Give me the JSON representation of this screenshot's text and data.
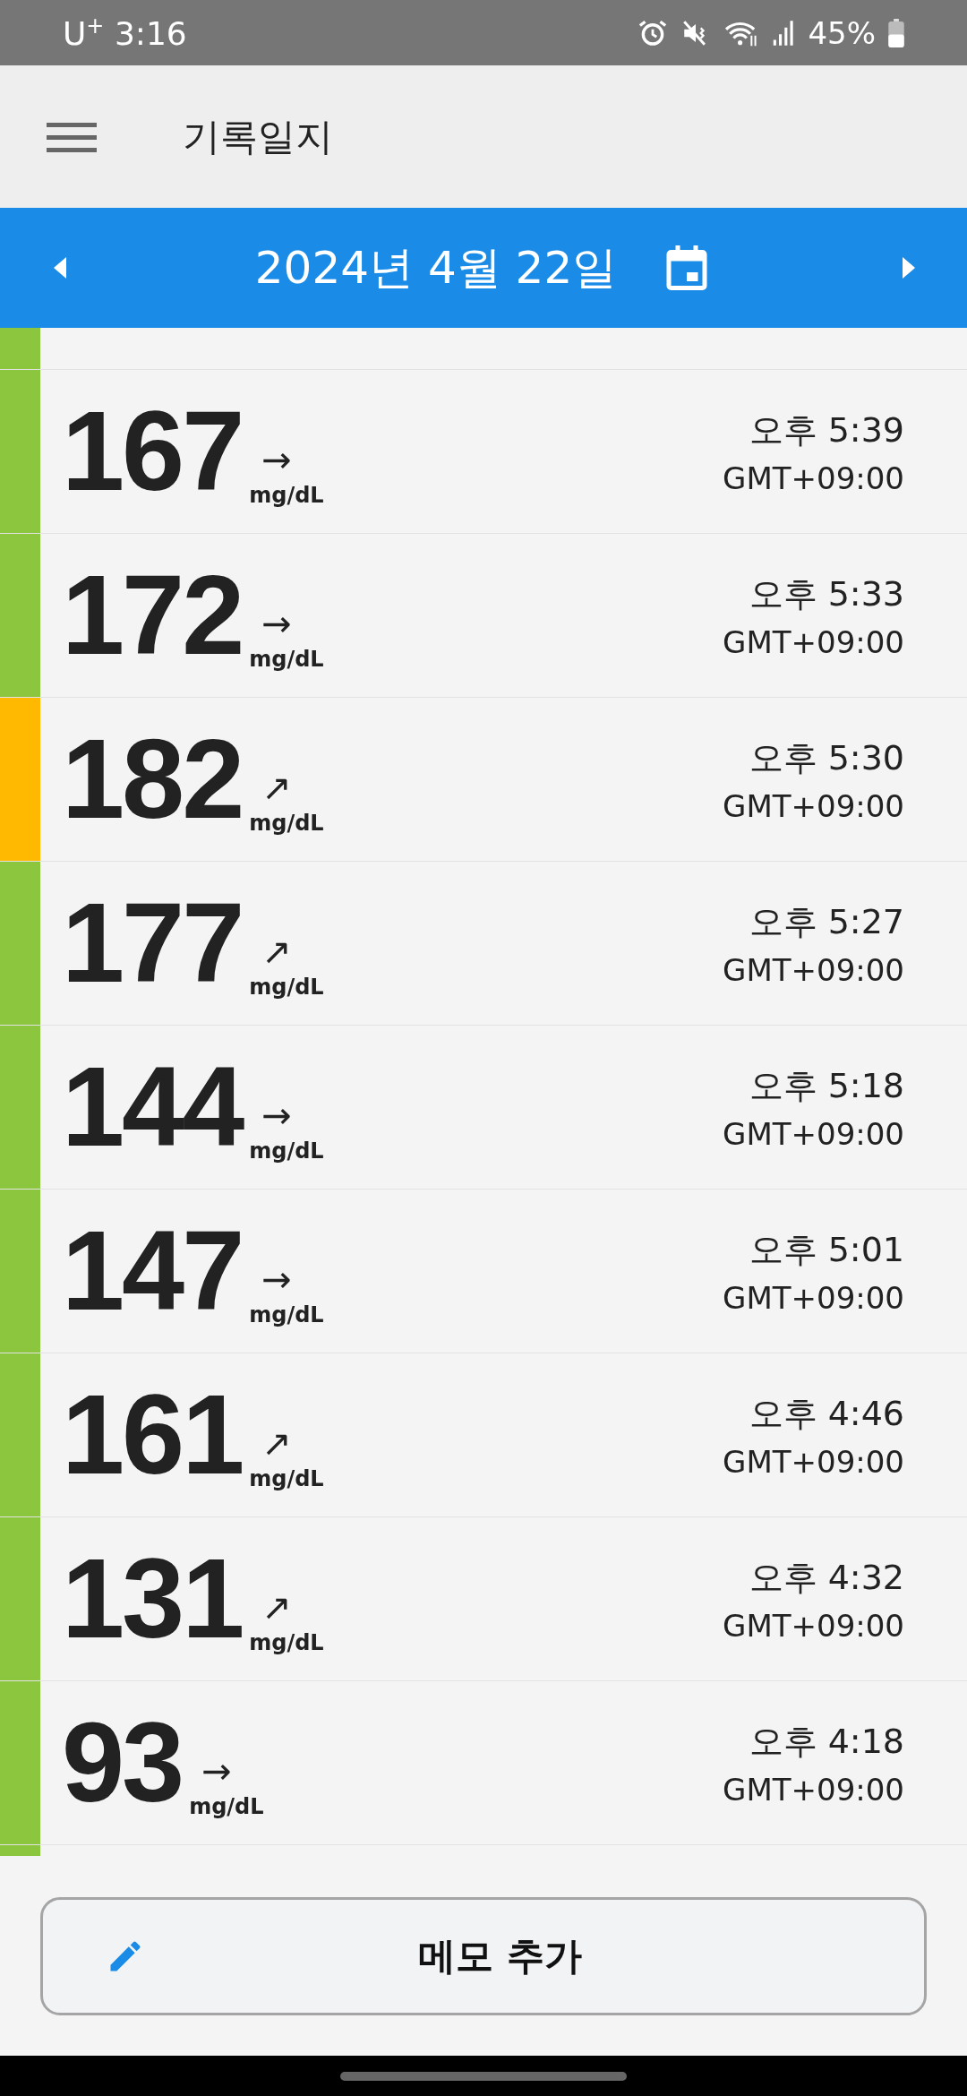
{
  "status_bar": {
    "carrier_time": "U$^{+}$ 3:16",
    "battery": "45%"
  },
  "app_bar": {
    "title": "기록일지"
  },
  "date_bar": {
    "date": "2024년 4월 22일"
  },
  "readings": [
    {
      "kind": "partial",
      "color": "#8cc63f"
    },
    {
      "kind": "reading",
      "value": "167",
      "arrow": "→",
      "unit": "mg/dL",
      "time": "오후 5:39",
      "zone": "GMT+09:00",
      "color": "#8cc63f"
    },
    {
      "kind": "reading",
      "value": "172",
      "arrow": "→",
      "unit": "mg/dL",
      "time": "오후 5:33",
      "zone": "GMT+09:00",
      "color": "#8cc63f"
    },
    {
      "kind": "reading",
      "value": "182",
      "arrow": "↗",
      "unit": "mg/dL",
      "time": "오후 5:30",
      "zone": "GMT+09:00",
      "color": "#ffb900"
    },
    {
      "kind": "reading",
      "value": "177",
      "arrow": "↗",
      "unit": "mg/dL",
      "time": "오후 5:27",
      "zone": "GMT+09:00",
      "color": "#8cc63f"
    },
    {
      "kind": "reading",
      "value": "144",
      "arrow": "→",
      "unit": "mg/dL",
      "time": "오후 5:18",
      "zone": "GMT+09:00",
      "color": "#8cc63f"
    },
    {
      "kind": "reading",
      "value": "147",
      "arrow": "→",
      "unit": "mg/dL",
      "time": "오후 5:01",
      "zone": "GMT+09:00",
      "color": "#8cc63f"
    },
    {
      "kind": "reading",
      "value": "161",
      "arrow": "↗",
      "unit": "mg/dL",
      "time": "오후 4:46",
      "zone": "GMT+09:00",
      "color": "#8cc63f"
    },
    {
      "kind": "reading",
      "value": "131",
      "arrow": "↗",
      "unit": "mg/dL",
      "time": "오후 4:32",
      "zone": "GMT+09:00",
      "color": "#8cc63f"
    },
    {
      "kind": "reading",
      "value": "93",
      "arrow": "→",
      "unit": "mg/dL",
      "time": "오후 4:18",
      "zone": "GMT+09:00",
      "color": "#8cc63f"
    },
    {
      "kind": "partial-bottom",
      "color": "#8cc63f"
    }
  ],
  "memo_button": {
    "label": "메모 추가"
  }
}
